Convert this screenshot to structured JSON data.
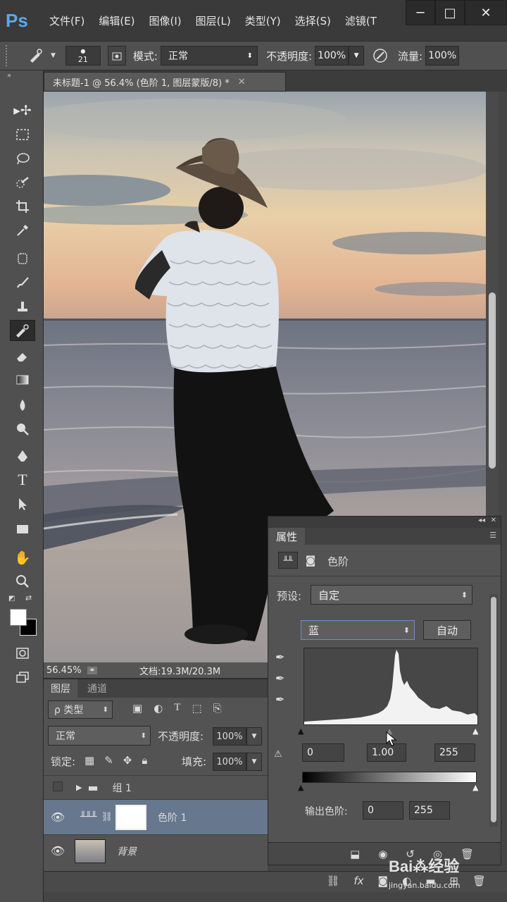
{
  "app": {
    "logo": "Ps"
  },
  "menu": [
    "文件(F)",
    "编辑(E)",
    "图像(I)",
    "图层(L)",
    "类型(Y)",
    "选择(S)",
    "滤镜(T"
  ],
  "window_controls": {
    "minimize": "─",
    "restore": "□",
    "close": "✕"
  },
  "options_bar": {
    "brush_size": "21",
    "mode_label": "模式:",
    "mode_value": "正常",
    "opacity_label": "不透明度:",
    "opacity_value": "100%",
    "flow_label": "流量:",
    "flow_value": "100%"
  },
  "document": {
    "tab_title": "未标题-1 @ 56.4% (色阶 1, 图层蒙版/8) *",
    "close": "✕",
    "zoom": "56.45%",
    "doc_size": "文档:19.3M/20.3M"
  },
  "layers_panel": {
    "tabs": [
      "图层",
      "通道"
    ],
    "filter_label": "ρ 类型",
    "blend_mode": "正常",
    "opacity_label": "不透明度:",
    "opacity_value": "100%",
    "lock_label": "锁定:",
    "fill_label": "填充:",
    "fill_value": "100%",
    "layers": [
      {
        "name": "组 1",
        "type": "group"
      },
      {
        "name": "色阶 1",
        "type": "adjustment"
      },
      {
        "name": "背景",
        "type": "background"
      }
    ]
  },
  "properties_panel": {
    "tab": "属性",
    "title": "色阶",
    "preset_label": "预设:",
    "preset_value": "自定",
    "channel_value": "蓝",
    "auto_button": "自动",
    "input_black": "0",
    "input_gamma": "1.00",
    "input_white": "255",
    "output_label": "输出色阶:",
    "output_black": "0",
    "output_white": "255"
  },
  "watermark": {
    "brand": "Bai",
    "brand2": "经验",
    "url": "jingyan.baidu.com"
  },
  "colors": {
    "accent": "#5ba9e8",
    "panel": "#535353",
    "selected_layer": "#67778d"
  }
}
